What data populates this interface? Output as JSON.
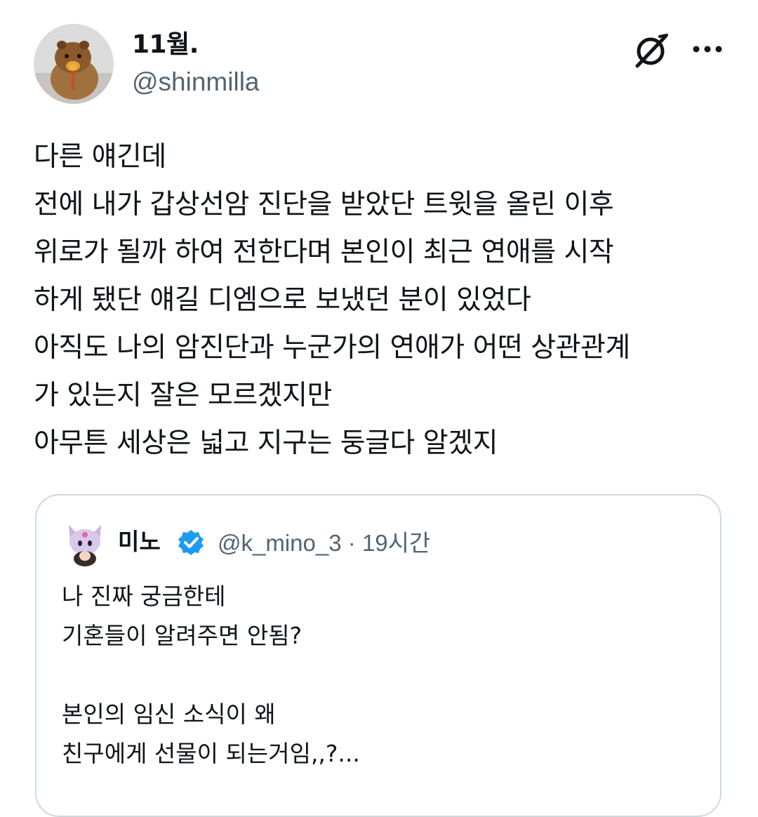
{
  "author": {
    "display_name": "11월.",
    "handle": "@shinmilla",
    "avatar_icon": "hamster-avatar"
  },
  "actions": {
    "grok_icon": "grok-icon",
    "more_icon": "more-dots-icon"
  },
  "tweet": {
    "lines": [
      "다른 얘긴데",
      "전에 내가 갑상선암 진단을 받았단 트윗을 올린 이후",
      "위로가 될까 하여 전한다며 본인이 최근 연애를 시작",
      "하게 됐단 얘길 디엠으로 보냈던 분이 있었다",
      "아직도 나의 암진단과 누군가의 연애가 어떤 상관관계",
      "가 있는지 잘은 모르겠지만",
      "아무튼 세상은 넓고 지구는 둥글다 알겠지"
    ]
  },
  "quoted_tweet": {
    "display_name": "미노",
    "handle": "@k_mino_3",
    "separator": "·",
    "time": "19시간",
    "verified_icon": "verified-badge-icon",
    "verified_color": "#1d9bf0",
    "lines": [
      "나 진짜 궁금한테",
      "기혼들이 알려주면 안됨?",
      "",
      "본인의 임신 소식이 왜",
      "친구에게 선물이 되는거임,,?..."
    ]
  }
}
